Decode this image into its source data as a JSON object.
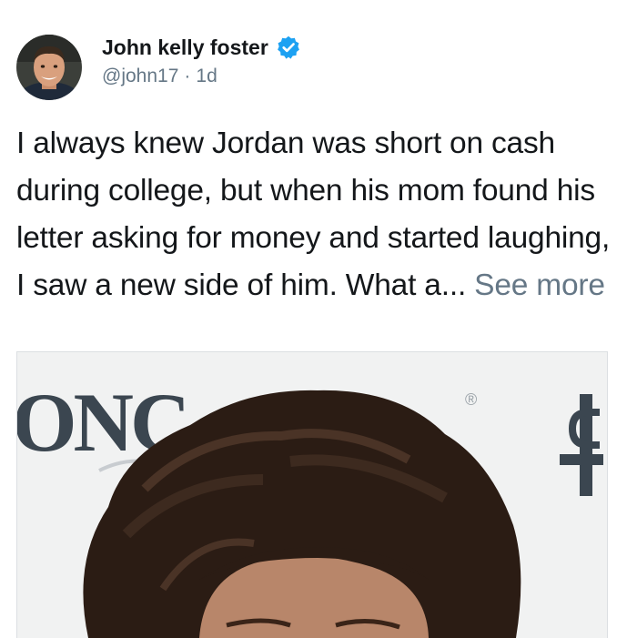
{
  "author": {
    "display_name": "John kelly foster",
    "handle": "@john17",
    "separator": "·",
    "timestamp": "1d",
    "verified": true,
    "verified_color": "#1da1f2"
  },
  "tweet": {
    "body": "I always knew Jordan was short on cash during college, but when his mom found his letter asking for money and started laughing, I saw a new side of him. What a...",
    "see_more_label": "See more"
  },
  "media": {
    "backdrop_text": "ONC",
    "registered_mark": "®",
    "backdrop_color": "#f1f2f2",
    "logo_color": "#3b4650"
  },
  "icons": {
    "verified": "verified-badge-icon"
  }
}
